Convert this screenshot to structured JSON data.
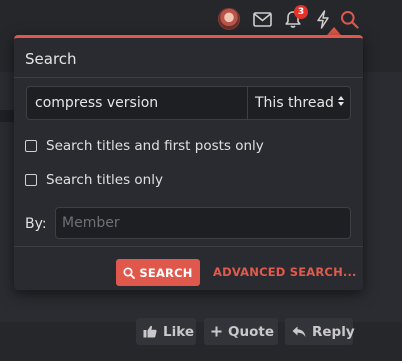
{
  "topnav": {
    "avatar_icon": "user-avatar",
    "inbox_icon": "envelope-icon",
    "alerts_icon": "bell-icon",
    "alerts_count": "3",
    "whats_new_icon": "bolt-icon",
    "search_icon": "search-icon"
  },
  "search_popup": {
    "title": "Search",
    "keywords": "compress version",
    "scope_selected": "This thread",
    "option_titles_first_posts": "Search titles and first posts only",
    "option_titles_only": "Search titles only",
    "by_label": "By:",
    "member_placeholder": "Member",
    "search_button": "SEARCH",
    "advanced_link": "ADVANCED SEARCH..."
  },
  "post_actions": {
    "like": "Like",
    "quote": "Quote",
    "reply": "Reply"
  },
  "colors": {
    "accent": "#e0584b",
    "background": "#26272b",
    "popup_bg": "#2a2b30",
    "badge": "#e2332a"
  }
}
